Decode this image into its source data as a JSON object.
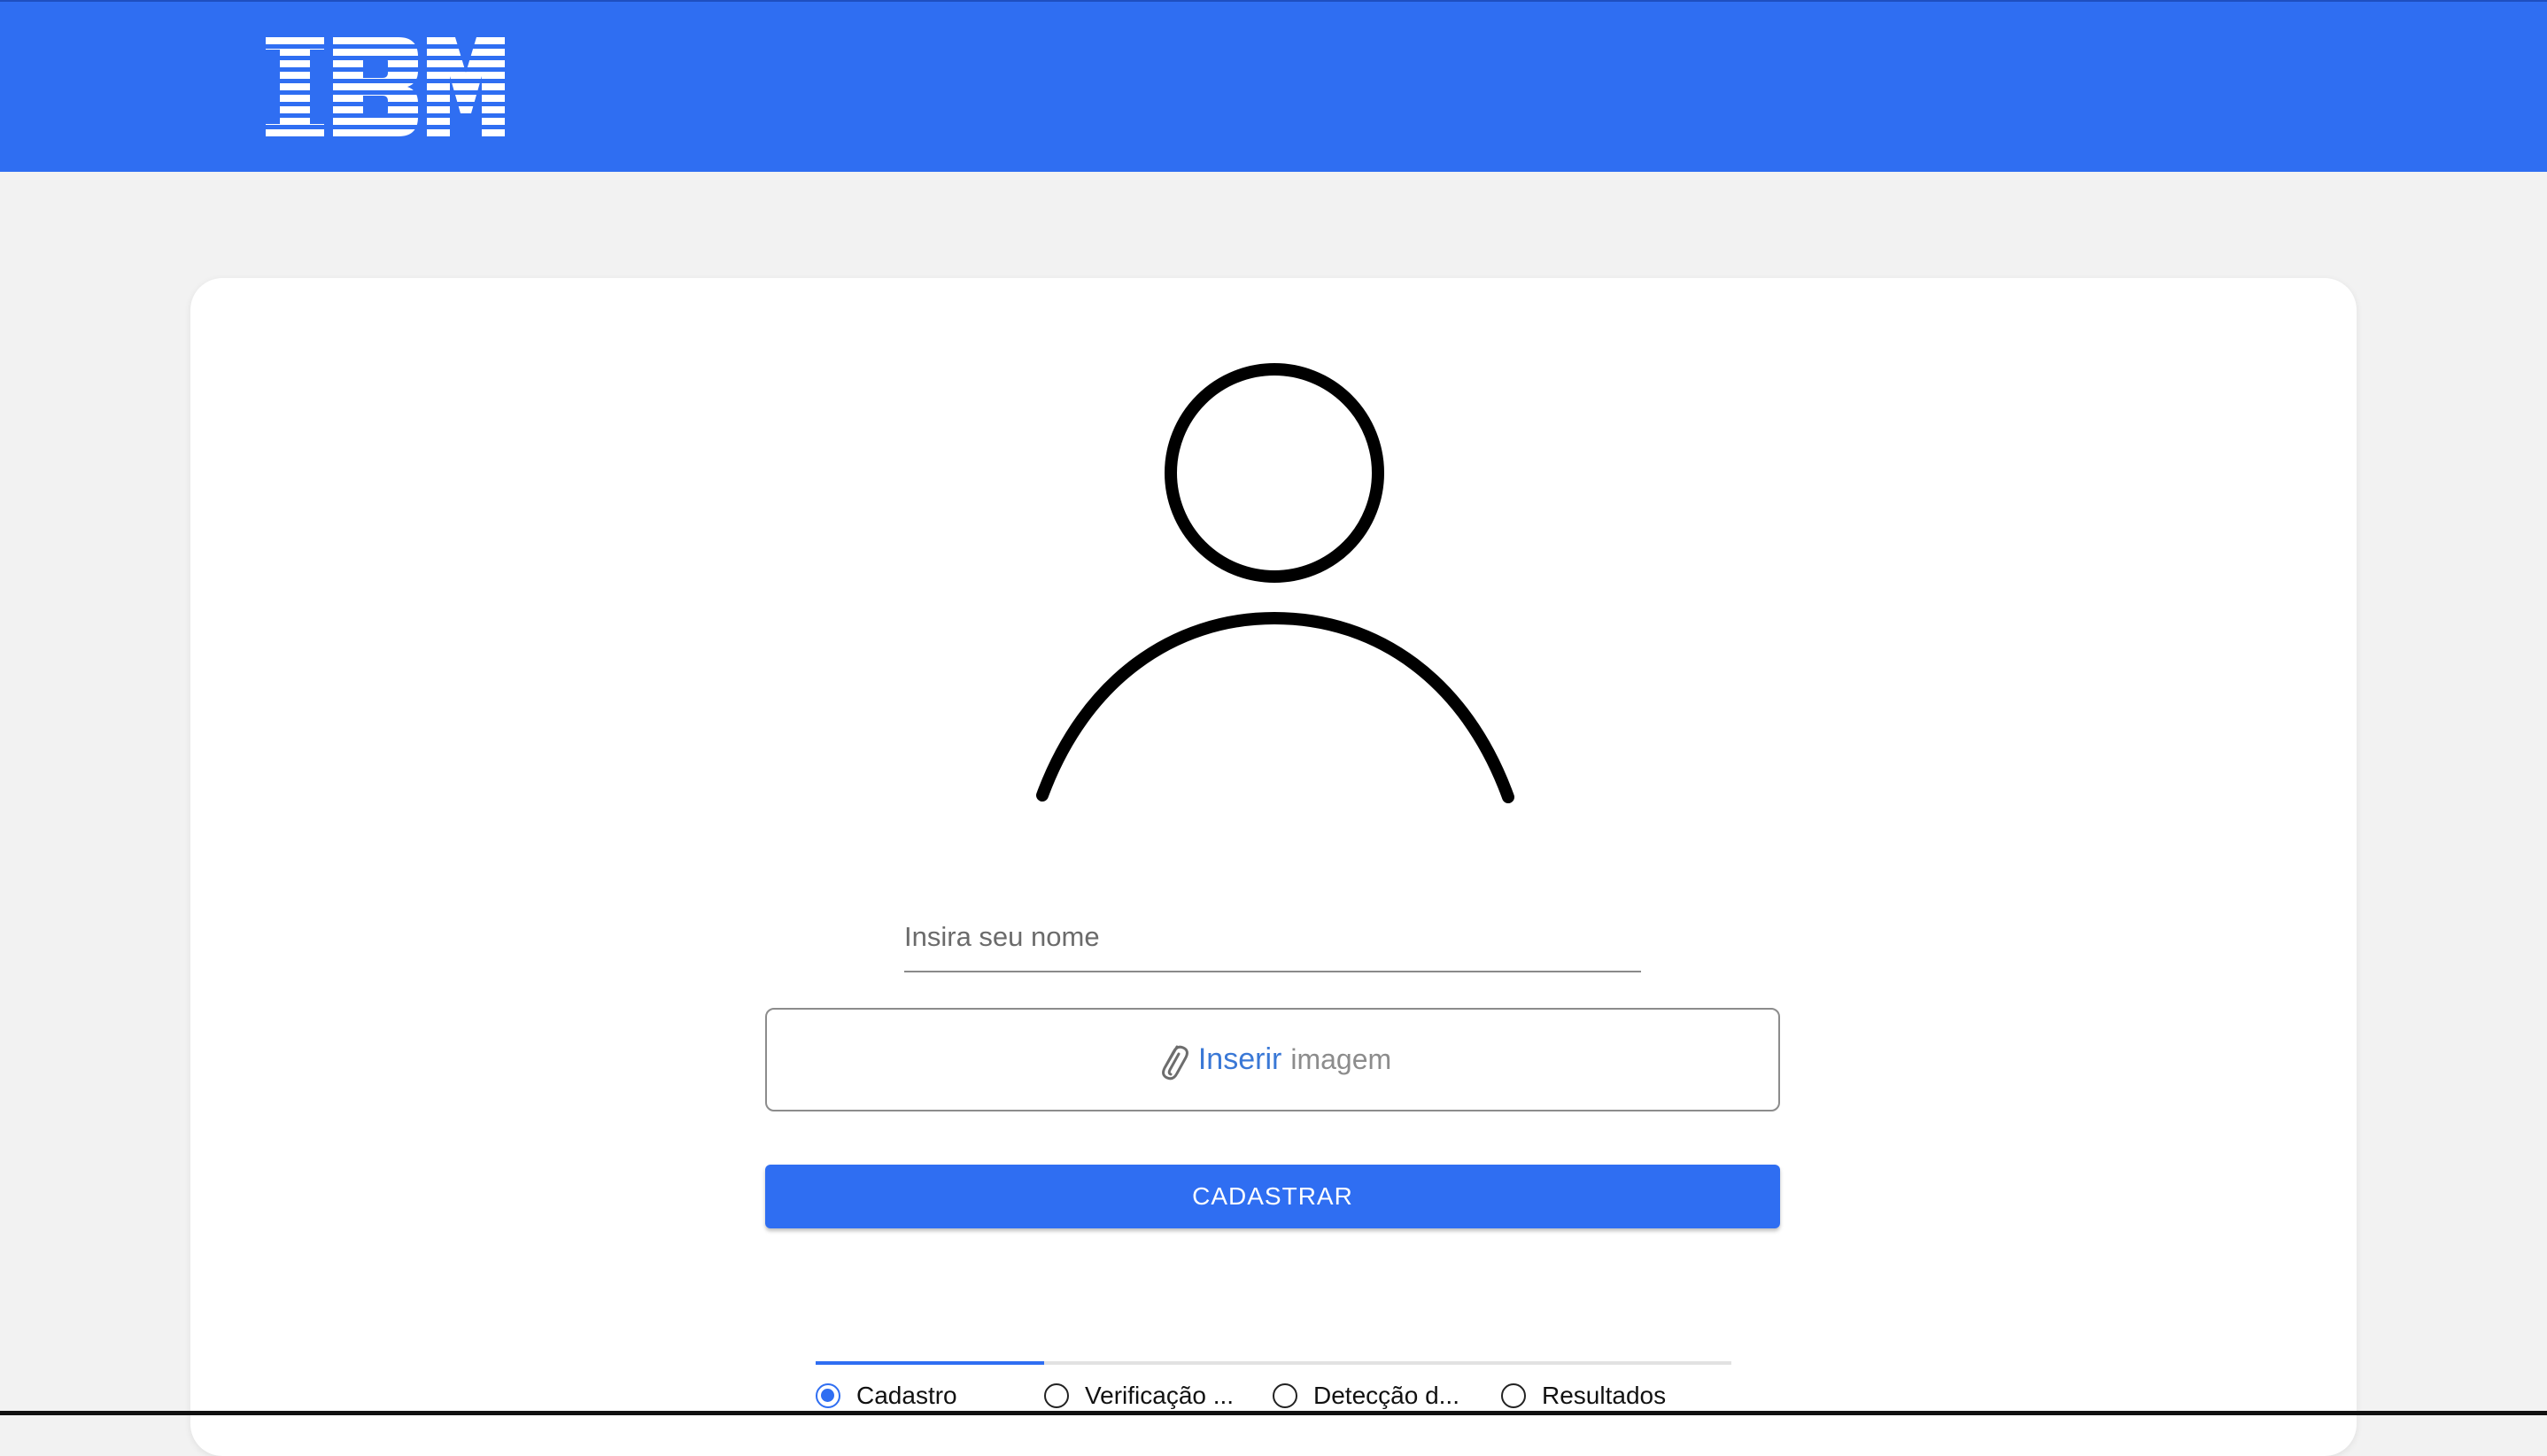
{
  "header": {
    "brand": "IBM",
    "background_color": "#2f6ef2"
  },
  "form": {
    "avatar_icon": "user-icon",
    "name_placeholder": "Insira seu nome",
    "upload": {
      "icon": "paperclip-icon",
      "link_text": "Inserir",
      "rest_text": "imagem"
    },
    "submit_label": "CADASTRAR"
  },
  "stepper": {
    "steps": [
      {
        "label": "Cadastro",
        "active": true
      },
      {
        "label": "Verificação ...",
        "active": false
      },
      {
        "label": "Detecção d...",
        "active": false
      },
      {
        "label": "Resultados",
        "active": false
      }
    ],
    "accent_color": "#2f6ef2"
  }
}
